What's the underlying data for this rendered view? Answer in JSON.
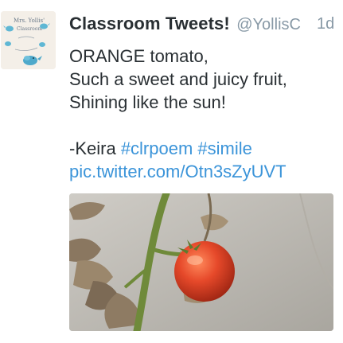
{
  "tweet": {
    "display_name": "Classroom Tweets!",
    "screen_name": "@YollisC",
    "timestamp": "1d",
    "lines": [
      "ORANGE tomato,",
      "Such a sweet and juicy fruit,",
      "Shining like the sun!",
      "",
      "-Keira"
    ],
    "hashtags": [
      "#clrpoem",
      "#simile"
    ],
    "media_link": "pic.twitter.com/Otn3sZyUVT"
  },
  "avatar": {
    "handwritten_text": "Mrs. Yollis' Classroom"
  },
  "colors": {
    "name": "#292f33",
    "secondary": "#8899a6",
    "link": "#3b94d9",
    "tomato": "#e0472a"
  },
  "icons": {
    "avatar_birds": "twitter-bird-icon"
  }
}
